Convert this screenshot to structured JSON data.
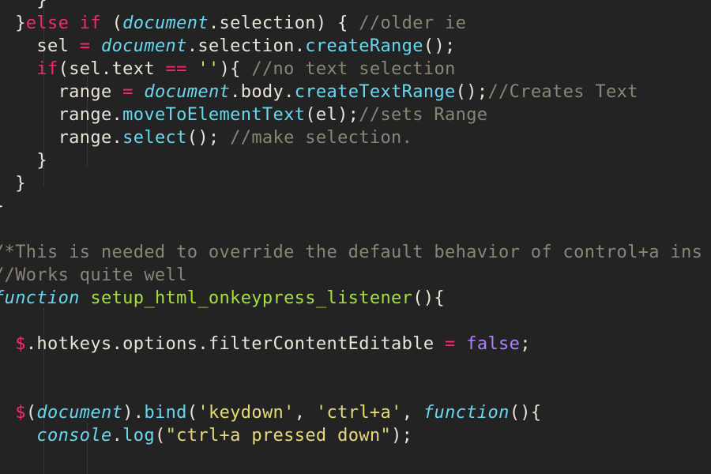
{
  "colors": {
    "background": "#232323",
    "plain": "#eae5d8",
    "keyword": "#f92672",
    "object": "#66d9ef",
    "function": "#66d9ef",
    "definition": "#a6e22e",
    "string": "#e6db74",
    "boolean": "#ae81ff",
    "comment": "#8a8575"
  },
  "lines": [
    {
      "tokens": [
        {
          "t": "plain",
          "v": "    }"
        }
      ]
    },
    {
      "tokens": [
        {
          "t": "plain",
          "v": "  }"
        },
        {
          "t": "kw",
          "v": "else if"
        },
        {
          "t": "plain",
          "v": " ("
        },
        {
          "t": "obj",
          "v": "document"
        },
        {
          "t": "plain",
          "v": ".selection) { "
        },
        {
          "t": "cmt",
          "v": "//older ie"
        }
      ]
    },
    {
      "tokens": [
        {
          "t": "plain",
          "v": "    sel "
        },
        {
          "t": "op",
          "v": "="
        },
        {
          "t": "plain",
          "v": " "
        },
        {
          "t": "obj",
          "v": "document"
        },
        {
          "t": "plain",
          "v": ".selection."
        },
        {
          "t": "fn",
          "v": "createRange"
        },
        {
          "t": "plain",
          "v": "();"
        }
      ]
    },
    {
      "tokens": [
        {
          "t": "plain",
          "v": "    "
        },
        {
          "t": "kw",
          "v": "if"
        },
        {
          "t": "plain",
          "v": "(sel.text "
        },
        {
          "t": "op",
          "v": "=="
        },
        {
          "t": "plain",
          "v": " "
        },
        {
          "t": "str",
          "v": "''"
        },
        {
          "t": "plain",
          "v": "){ "
        },
        {
          "t": "cmt",
          "v": "//no text selection"
        }
      ]
    },
    {
      "tokens": [
        {
          "t": "plain",
          "v": "      range "
        },
        {
          "t": "op",
          "v": "="
        },
        {
          "t": "plain",
          "v": " "
        },
        {
          "t": "obj",
          "v": "document"
        },
        {
          "t": "plain",
          "v": ".body."
        },
        {
          "t": "fn",
          "v": "createTextRange"
        },
        {
          "t": "plain",
          "v": "();"
        },
        {
          "t": "cmt",
          "v": "//Creates Text"
        }
      ]
    },
    {
      "tokens": [
        {
          "t": "plain",
          "v": "      range."
        },
        {
          "t": "fn",
          "v": "moveToElementText"
        },
        {
          "t": "plain",
          "v": "(el);"
        },
        {
          "t": "cmt",
          "v": "//sets Range"
        }
      ]
    },
    {
      "tokens": [
        {
          "t": "plain",
          "v": "      range."
        },
        {
          "t": "fn",
          "v": "select"
        },
        {
          "t": "plain",
          "v": "(); "
        },
        {
          "t": "cmt",
          "v": "//make selection."
        }
      ]
    },
    {
      "tokens": [
        {
          "t": "plain",
          "v": "    }"
        }
      ]
    },
    {
      "tokens": [
        {
          "t": "plain",
          "v": "  }"
        }
      ]
    },
    {
      "tokens": [
        {
          "t": "plain",
          "v": "}"
        }
      ]
    },
    {
      "tokens": []
    },
    {
      "tokens": [
        {
          "t": "cmt",
          "v": "/*This is needed to override the default behavior of control+a ins"
        }
      ]
    },
    {
      "tokens": [
        {
          "t": "cmt",
          "v": "//Works quite well"
        }
      ]
    },
    {
      "tokens": [
        {
          "t": "obj",
          "v": "function"
        },
        {
          "t": "plain",
          "v": " "
        },
        {
          "t": "defn",
          "v": "setup_html_onkeypress_listener"
        },
        {
          "t": "plain",
          "v": "(){"
        }
      ]
    },
    {
      "tokens": []
    },
    {
      "tokens": [
        {
          "t": "plain",
          "v": "  "
        },
        {
          "t": "kw",
          "v": "$"
        },
        {
          "t": "plain",
          "v": ".hotkeys.options.filterContentEditable "
        },
        {
          "t": "op",
          "v": "="
        },
        {
          "t": "plain",
          "v": " "
        },
        {
          "t": "bool",
          "v": "false"
        },
        {
          "t": "plain",
          "v": ";"
        }
      ]
    },
    {
      "tokens": []
    },
    {
      "tokens": []
    },
    {
      "tokens": [
        {
          "t": "plain",
          "v": "  "
        },
        {
          "t": "kw",
          "v": "$"
        },
        {
          "t": "plain",
          "v": "("
        },
        {
          "t": "obj",
          "v": "document"
        },
        {
          "t": "plain",
          "v": ")."
        },
        {
          "t": "fn",
          "v": "bind"
        },
        {
          "t": "plain",
          "v": "("
        },
        {
          "t": "str",
          "v": "'keydown'"
        },
        {
          "t": "plain",
          "v": ", "
        },
        {
          "t": "str",
          "v": "'ctrl+a'"
        },
        {
          "t": "plain",
          "v": ", "
        },
        {
          "t": "obj",
          "v": "function"
        },
        {
          "t": "plain",
          "v": "(){"
        }
      ]
    },
    {
      "tokens": [
        {
          "t": "plain",
          "v": "    "
        },
        {
          "t": "obj",
          "v": "console"
        },
        {
          "t": "plain",
          "v": "."
        },
        {
          "t": "fn",
          "v": "log"
        },
        {
          "t": "plain",
          "v": "("
        },
        {
          "t": "str",
          "v": "\"ctrl+a pressed down\""
        },
        {
          "t": "plain",
          "v": ");"
        }
      ]
    },
    {
      "tokens": []
    }
  ]
}
